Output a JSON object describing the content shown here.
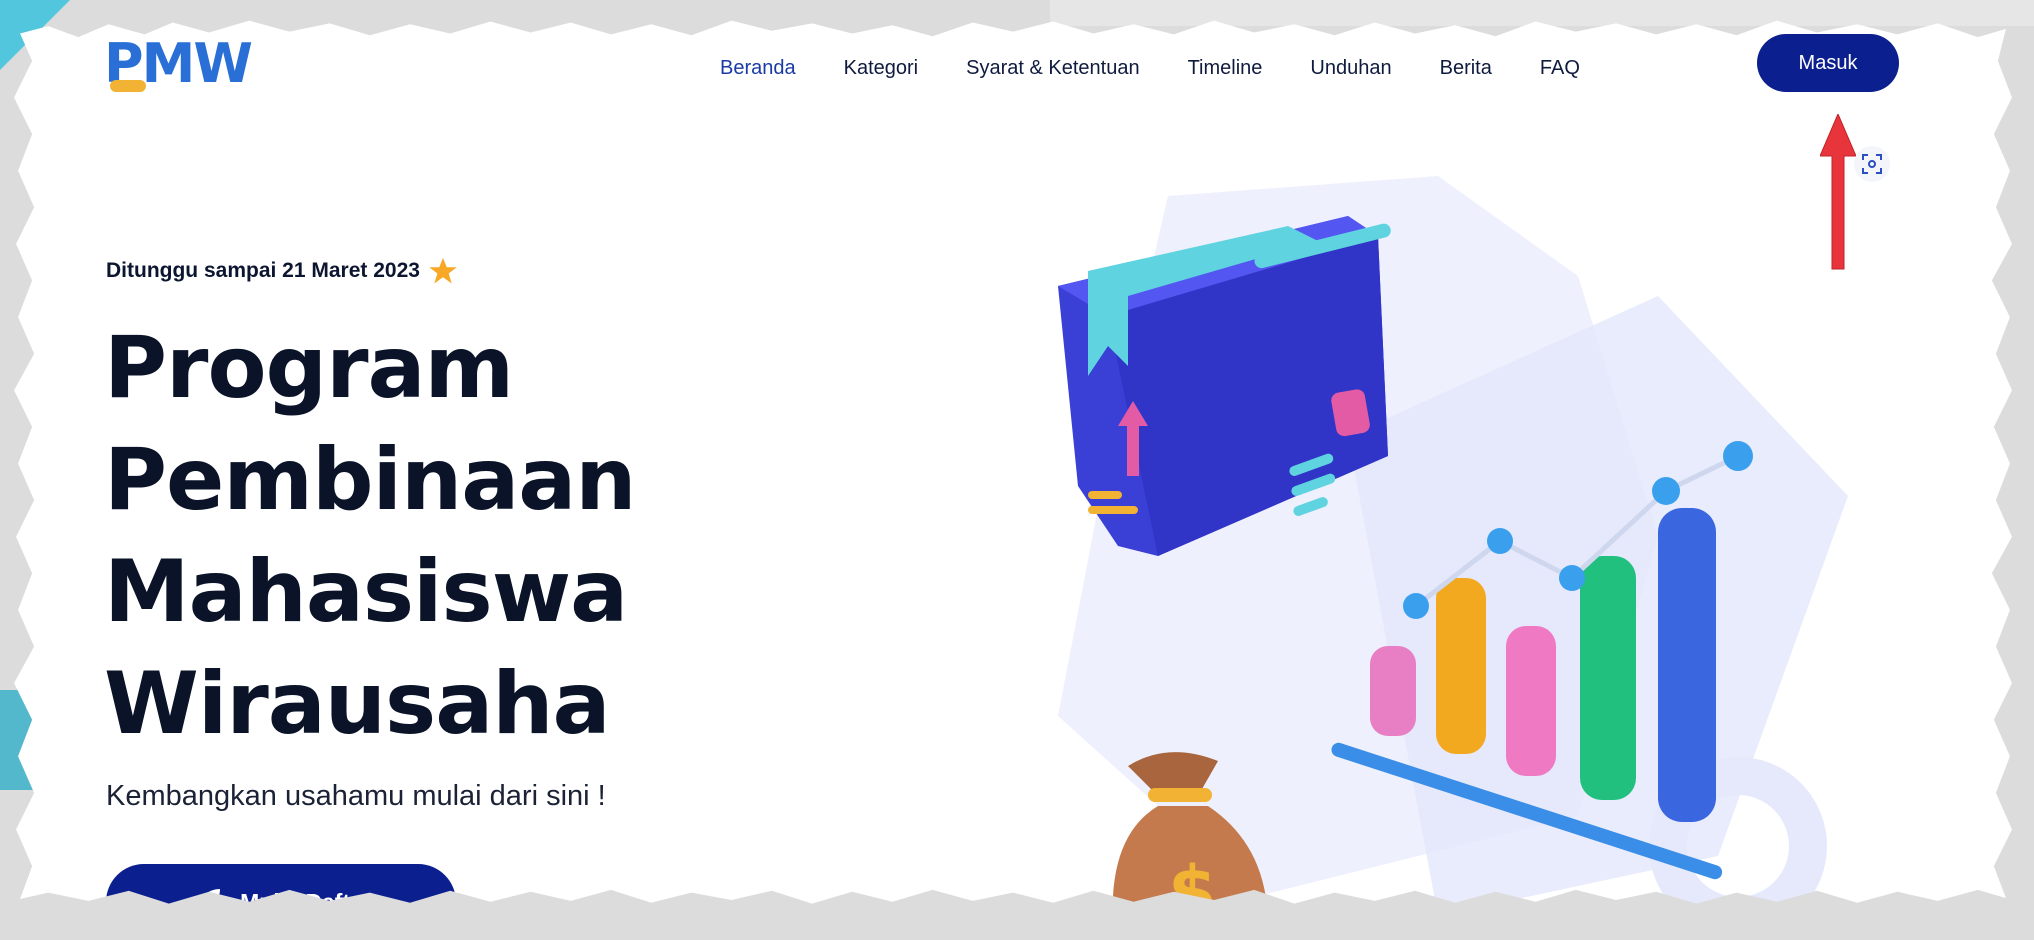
{
  "logo": {
    "text": "PMW",
    "alt": "PMW"
  },
  "nav": {
    "items": [
      {
        "label": "Beranda",
        "active": true
      },
      {
        "label": "Kategori",
        "active": false
      },
      {
        "label": "Syarat & Ketentuan",
        "active": false
      },
      {
        "label": "Timeline",
        "active": false
      },
      {
        "label": "Unduhan",
        "active": false
      },
      {
        "label": "Berita",
        "active": false
      },
      {
        "label": "FAQ",
        "active": false
      }
    ],
    "login_label": "Masuk"
  },
  "hero": {
    "tagline": "Ditunggu sampai 21 Maret 2023",
    "title_lines": [
      "Program",
      "Pembinaan",
      "Mahasiswa",
      "Wirausaha"
    ],
    "subtitle": "Kembangkan usahamu mulai dari sini !",
    "cta_label": "Mulai Daftar"
  },
  "icons": {
    "star": "star-icon",
    "rocket": "rocket-icon",
    "scan": "scan-icon",
    "annotation_arrow": "arrow-up-icon"
  },
  "colors": {
    "primary": "#0c1f8f",
    "accent_star": "#f7a825",
    "annotation_red": "#e8353b",
    "heading": "#0a1327"
  }
}
